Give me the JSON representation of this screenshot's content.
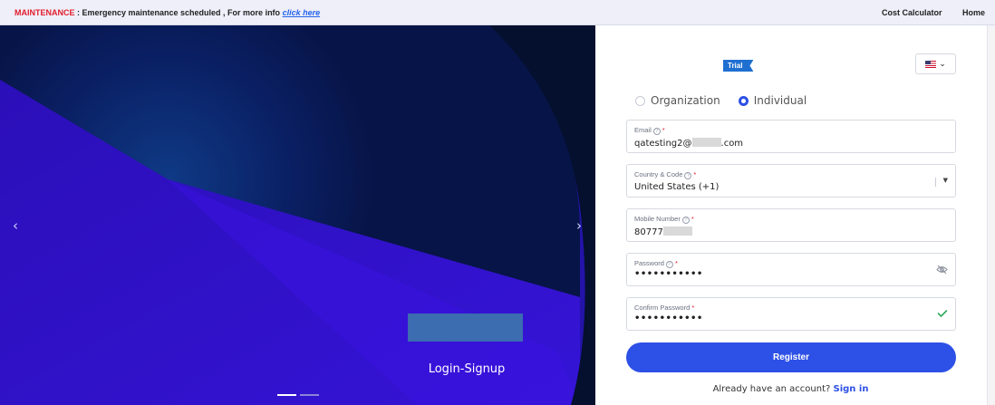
{
  "topbar": {
    "maintenance_label": "MAINTENANCE",
    "message": " : Emergency maintenance scheduled , For more info ",
    "link_text": "click here",
    "nav": {
      "cost_calculator": "Cost Calculator",
      "home": "Home"
    }
  },
  "hero": {
    "caption": "Login-Signup",
    "prev_arrow": "‹",
    "next_arrow": "›",
    "slides": 2,
    "active_slide": 1
  },
  "form": {
    "trial_badge": "Trial",
    "language": {
      "icon": "us-flag-icon",
      "chevron": "⌄"
    },
    "account_types": {
      "organization": "Organization",
      "individual": "Individual",
      "selected": "Individual"
    },
    "email": {
      "label": "Email",
      "value_prefix": "qatesting2@",
      "value_suffix": ".com"
    },
    "country": {
      "label": "Country & Code",
      "value": "United States (+1)"
    },
    "mobile": {
      "label": "Mobile Number",
      "value_prefix": "80777"
    },
    "password": {
      "label": "Password",
      "value": "•••••••••••"
    },
    "confirm_password": {
      "label": "Confirm Password",
      "value": "•••••••••••"
    },
    "register_label": "Register",
    "already_text": "Already have an account?",
    "signin_label": "Sign in"
  },
  "colors": {
    "accent": "#2d50e6",
    "maintenance": "#e21d2c",
    "hero_dark": "#061244",
    "hero_purple": "#2a10c8",
    "valid": "#2eaa5c"
  }
}
